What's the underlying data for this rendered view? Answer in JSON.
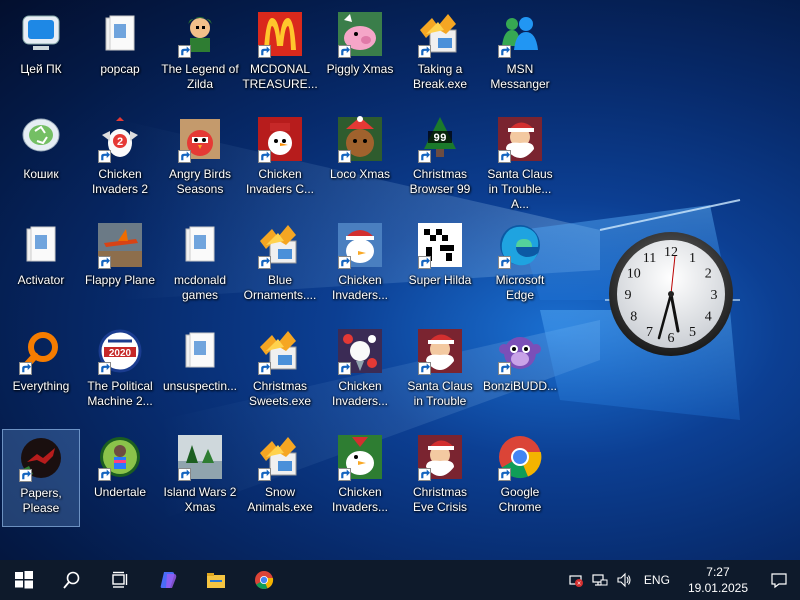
{
  "desktop": {
    "icons": [
      {
        "label": "Цей ПК",
        "icon": "computer-icon",
        "col": 0,
        "row": 0,
        "shortcut": false
      },
      {
        "label": "popcap",
        "icon": "folder-icon",
        "col": 1,
        "row": 0,
        "shortcut": false
      },
      {
        "label": "The Legend of Zilda",
        "icon": "game-character-icon",
        "col": 2,
        "row": 0,
        "shortcut": true
      },
      {
        "label": "MCDONAL TREASURE...",
        "icon": "mcdonalds-icon",
        "col": 3,
        "row": 0,
        "shortcut": true
      },
      {
        "label": "Piggly Xmas",
        "icon": "pig-icon",
        "col": 4,
        "row": 0,
        "shortcut": true
      },
      {
        "label": "Taking a Break.exe",
        "icon": "installer-icon",
        "col": 5,
        "row": 0,
        "shortcut": true
      },
      {
        "label": "MSN Messanger",
        "icon": "msn-icon",
        "col": 6,
        "row": 0,
        "shortcut": true
      },
      {
        "label": "Кошик",
        "icon": "recycle-bin-icon",
        "col": 0,
        "row": 1,
        "shortcut": false
      },
      {
        "label": "Chicken Invaders 2",
        "icon": "chicken-icon",
        "col": 1,
        "row": 1,
        "shortcut": true
      },
      {
        "label": "Angry Birds Seasons",
        "icon": "angry-bird-icon",
        "col": 2,
        "row": 1,
        "shortcut": true
      },
      {
        "label": "Chicken Invaders C...",
        "icon": "snowman-icon",
        "col": 3,
        "row": 1,
        "shortcut": true
      },
      {
        "label": "Loco Xmas",
        "icon": "bear-icon",
        "col": 4,
        "row": 1,
        "shortcut": true
      },
      {
        "label": "Christmas Browser 99",
        "icon": "tree-99-icon",
        "col": 5,
        "row": 1,
        "shortcut": true
      },
      {
        "label": "Santa Claus in Trouble... A...",
        "icon": "santa-icon",
        "col": 6,
        "row": 1,
        "shortcut": true
      },
      {
        "label": "Activator",
        "icon": "folder-icon",
        "col": 0,
        "row": 2,
        "shortcut": false
      },
      {
        "label": "Flappy Plane",
        "icon": "plane-icon",
        "col": 1,
        "row": 2,
        "shortcut": true
      },
      {
        "label": "mcdonald games",
        "icon": "folder-icon",
        "col": 2,
        "row": 2,
        "shortcut": false
      },
      {
        "label": "Blue Ornaments....",
        "icon": "installer-icon",
        "col": 3,
        "row": 2,
        "shortcut": true
      },
      {
        "label": "Chicken Invaders...",
        "icon": "chicken-santa-icon",
        "col": 4,
        "row": 2,
        "shortcut": true
      },
      {
        "label": "Super Hilda",
        "icon": "pixel-icon",
        "col": 5,
        "row": 2,
        "shortcut": true
      },
      {
        "label": "Microsoft Edge",
        "icon": "edge-icon",
        "col": 6,
        "row": 2,
        "shortcut": true
      },
      {
        "label": "Everything",
        "icon": "search-magnifier-icon",
        "col": 0,
        "row": 3,
        "shortcut": true
      },
      {
        "label": "The Political Machine 2...",
        "icon": "political-icon",
        "col": 1,
        "row": 3,
        "shortcut": true
      },
      {
        "label": "unsuspectin...",
        "icon": "folder-icon",
        "col": 2,
        "row": 3,
        "shortcut": false
      },
      {
        "label": "Christmas Sweets.exe",
        "icon": "installer-icon",
        "col": 3,
        "row": 3,
        "shortcut": true
      },
      {
        "label": "Chicken Invaders...",
        "icon": "space-icon",
        "col": 4,
        "row": 3,
        "shortcut": true
      },
      {
        "label": "Santa Claus in Trouble",
        "icon": "santa-icon",
        "col": 5,
        "row": 3,
        "shortcut": true
      },
      {
        "label": "BonziBUDD...",
        "icon": "bonzi-icon",
        "col": 6,
        "row": 3,
        "shortcut": true
      },
      {
        "label": "Papers, Please",
        "icon": "papers-please-icon",
        "col": 0,
        "row": 4,
        "shortcut": true,
        "selected": true
      },
      {
        "label": "Undertale",
        "icon": "undertale-icon",
        "col": 1,
        "row": 4,
        "shortcut": true
      },
      {
        "label": "Island Wars 2 Xmas",
        "icon": "island-icon",
        "col": 2,
        "row": 4,
        "shortcut": true
      },
      {
        "label": "Snow Animals.exe",
        "icon": "installer-icon",
        "col": 3,
        "row": 4,
        "shortcut": true
      },
      {
        "label": "Chicken Invaders...",
        "icon": "chicken-green-icon",
        "col": 4,
        "row": 4,
        "shortcut": true
      },
      {
        "label": "Christmas Eve Crisis",
        "icon": "santa-icon",
        "col": 5,
        "row": 4,
        "shortcut": true
      },
      {
        "label": "Google Chrome",
        "icon": "chrome-icon",
        "col": 6,
        "row": 4,
        "shortcut": true
      }
    ]
  },
  "clock_gadget": {
    "numbers": [
      "12",
      "1",
      "2",
      "3",
      "4",
      "5",
      "6",
      "7",
      "8",
      "9",
      "10",
      "11"
    ]
  },
  "taskbar": {
    "pinned": [
      "start-icon",
      "search-icon",
      "task-view-icon",
      "copilot-icon",
      "file-explorer-icon",
      "chrome-icon"
    ],
    "tray": {
      "language": "ENG",
      "time": "7:27",
      "date": "19.01.2025"
    }
  }
}
